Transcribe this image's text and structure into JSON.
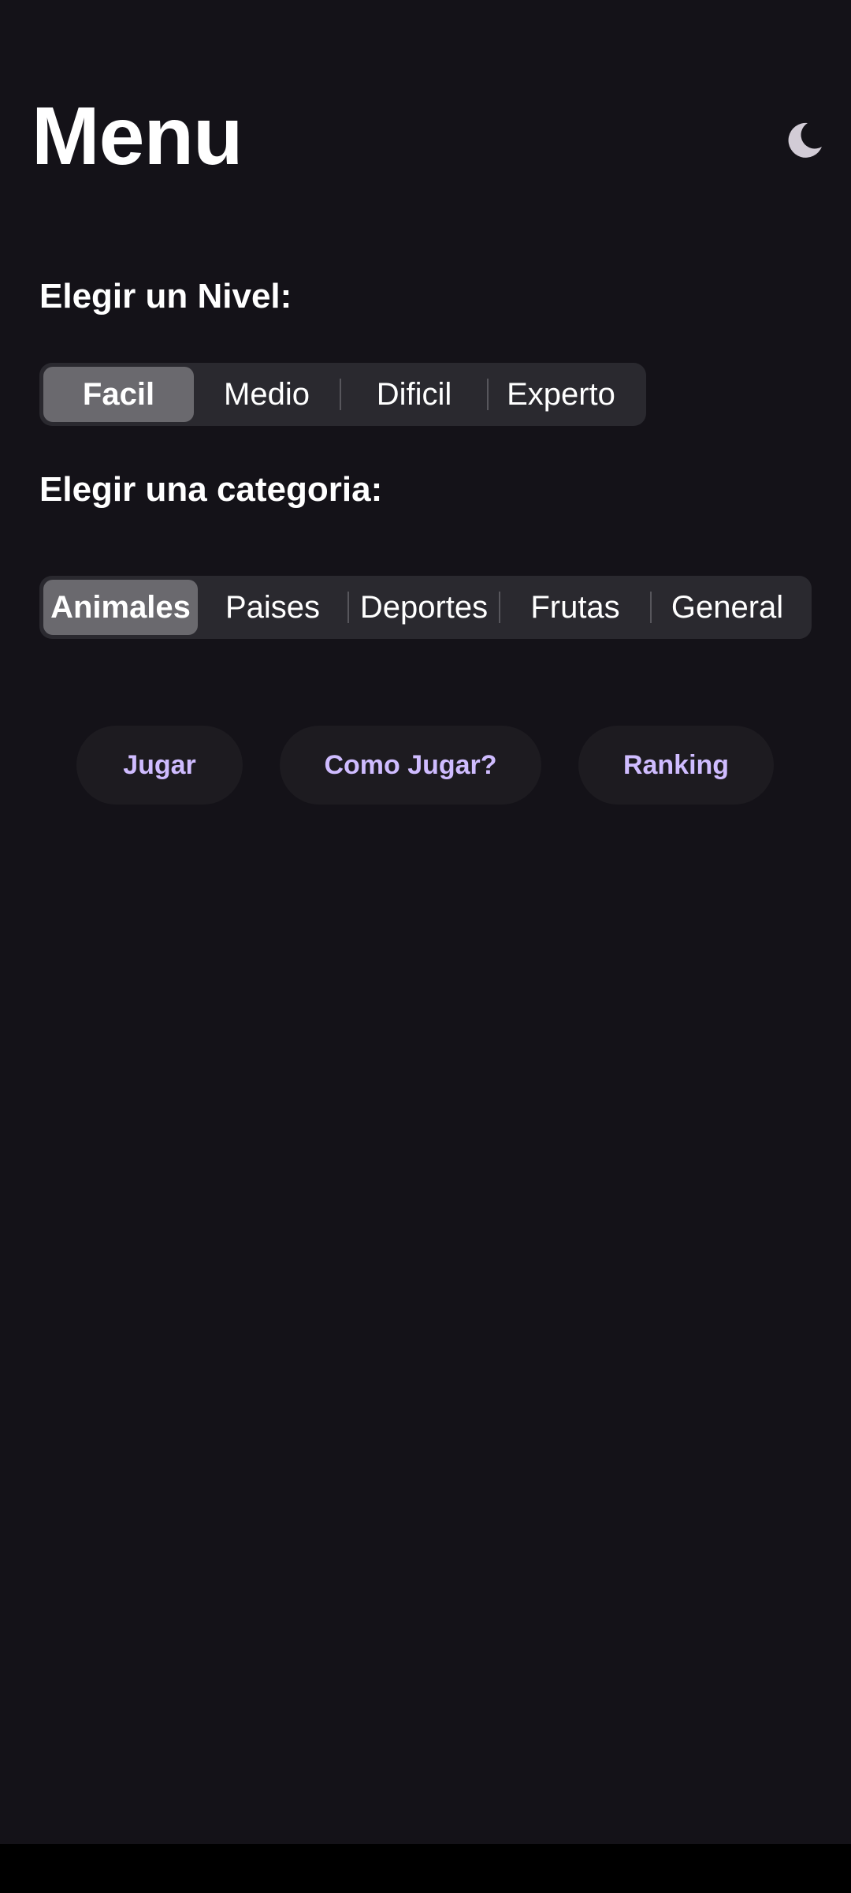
{
  "header": {
    "title": "Menu",
    "theme_icon": "moon-icon"
  },
  "level": {
    "label": "Elegir un Nivel:",
    "options": [
      "Facil",
      "Medio",
      "Dificil",
      "Experto"
    ],
    "selected": "Facil"
  },
  "category": {
    "label": "Elegir una categoria:",
    "options": [
      "Animales",
      "Paises",
      "Deportes",
      "Frutas",
      "General"
    ],
    "selected": "Animales"
  },
  "actions": {
    "play": "Jugar",
    "how_to_play": "Como Jugar?",
    "ranking": "Ranking"
  },
  "colors": {
    "background": "#141218",
    "accent": "#cfbcff",
    "segment_track": "#2a292f",
    "segment_selected": "#6a696e",
    "button_surface": "#1d1b20"
  }
}
